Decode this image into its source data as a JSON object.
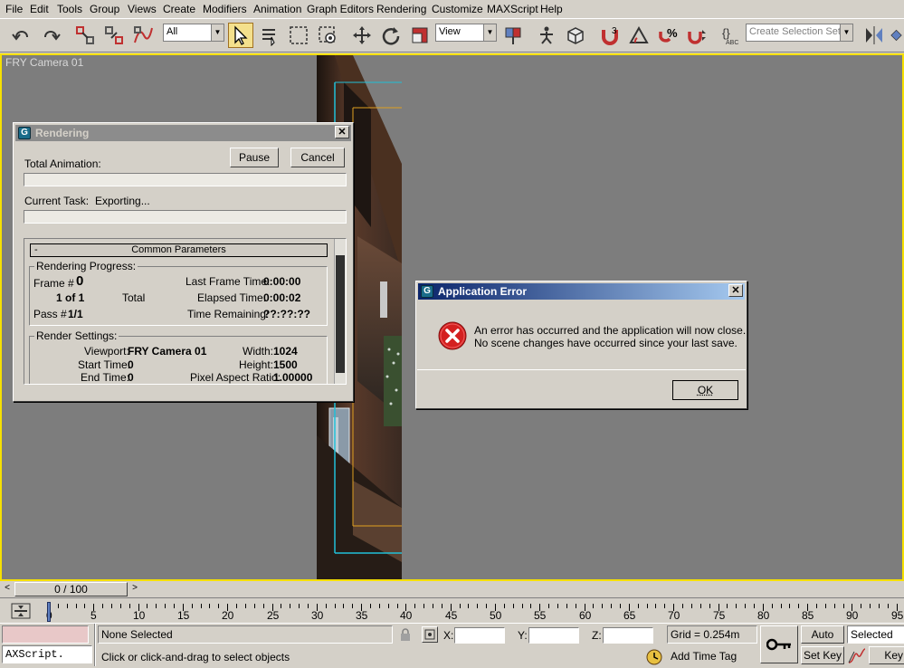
{
  "menu": [
    "File",
    "Edit",
    "Tools",
    "Group",
    "Views",
    "Create",
    "Modifiers",
    "Animation",
    "Graph Editors",
    "Rendering",
    "Customize",
    "MAXScript",
    "Help"
  ],
  "toolbar": {
    "selection_filter": "All",
    "reference_coord": "View",
    "named_selection_placeholder": "Create Selection Set"
  },
  "viewport": {
    "label": "FRY Camera 01"
  },
  "rendering_dialog": {
    "title": "Rendering",
    "pause_label": "Pause",
    "cancel_label": "Cancel",
    "total_animation_label": "Total Animation:",
    "current_task_label": "Current Task:",
    "current_task_value": "Exporting...",
    "rollout_toggle": "-",
    "rollout_title": "Common Parameters",
    "progress_group": "Rendering Progress:",
    "frame_label": "Frame #",
    "frame_value": "0",
    "frames_of": "1 of 1",
    "total_label": "Total",
    "pass_label": "Pass #",
    "pass_value": "1/1",
    "last_frame_label": "Last Frame Time:",
    "last_frame_value": "0:00:00",
    "elapsed_label": "Elapsed Time:",
    "elapsed_value": "0:00:02",
    "remaining_label": "Time Remaining:",
    "remaining_value": "??:??:??",
    "settings_group": "Render Settings:",
    "viewport_label": "Viewport:",
    "viewport_value": "FRY Camera 01",
    "width_label": "Width:",
    "width_value": "1024",
    "start_label": "Start Time:",
    "start_value": "0",
    "height_label": "Height:",
    "height_value": "1500",
    "end_label": "End Time:",
    "end_value": "0",
    "aspect_label": "Pixel Aspect Ratio:",
    "aspect_value": "1.00000"
  },
  "error_dialog": {
    "title": "Application Error",
    "line1": "An error has occurred and the application will now close.",
    "line2": "No scene changes have occurred since your last save.",
    "ok_label": "OK"
  },
  "timeline": {
    "frame_counter": "0 / 100",
    "ticks": [
      "0",
      "5",
      "10",
      "15",
      "20",
      "25",
      "30",
      "35",
      "40",
      "45",
      "50",
      "55",
      "60",
      "65",
      "70",
      "75",
      "80",
      "85",
      "90",
      "95"
    ]
  },
  "status": {
    "maxscript_text": "AXScript.",
    "selection": "None Selected",
    "prompt": "Click or click-and-drag to select objects",
    "x_label": "X:",
    "y_label": "Y:",
    "z_label": "Z:",
    "grid": "Grid = 0.254m",
    "add_time_tag": "Add Time Tag",
    "auto_key": "Auto Key",
    "selected": "Selected",
    "set_key": "Set Key",
    "key_filters": "Key"
  },
  "colors": {
    "active_viewport_border": "#f6e000",
    "title_active_start": "#0a246a",
    "title_active_end": "#a6caf0",
    "title_inactive": "#808080",
    "error_icon": "#d42020"
  }
}
